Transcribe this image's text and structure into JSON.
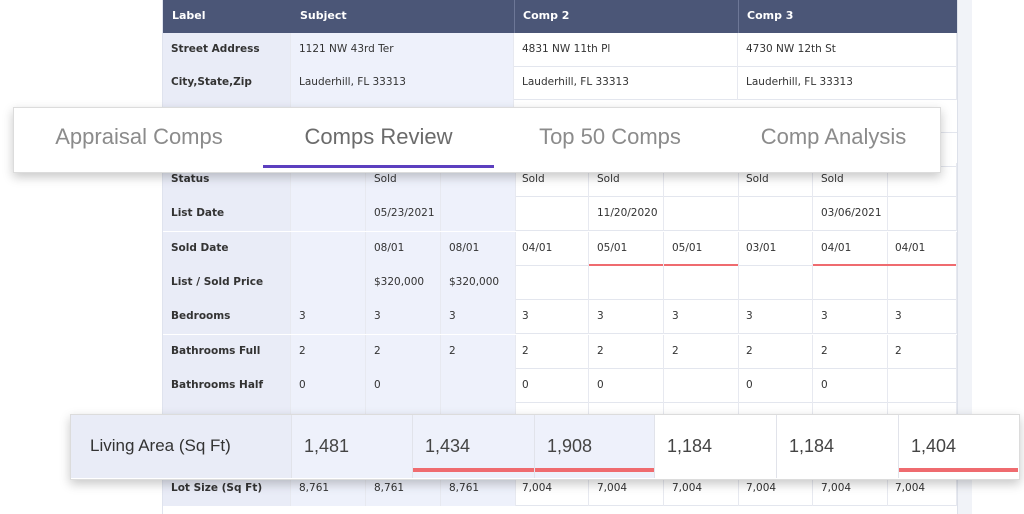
{
  "header": {
    "label": "Label",
    "subject": "Subject",
    "comp2": "Comp 2",
    "comp3": "Comp 3"
  },
  "rows_top": [
    {
      "label": "Street Address",
      "subject": "1121 NW 43rd Ter",
      "comp2": "4831 NW 11th Pl",
      "comp3": "4730 NW 12th St"
    },
    {
      "label": "City,State,Zip",
      "subject": "Lauderhill, FL 33313",
      "comp2": "Lauderhill, FL 33313",
      "comp3": "Lauderhill, FL 33313"
    }
  ],
  "tabs": [
    {
      "label": "Appraisal Comps",
      "active": false
    },
    {
      "label": "Comps Review",
      "active": true
    },
    {
      "label": "Top 50 Comps",
      "active": false
    },
    {
      "label": "Comp Analysis",
      "active": false
    }
  ],
  "rows": [
    {
      "label": "Status",
      "values": [
        "",
        "Sold",
        "",
        "Sold",
        "Sold",
        "",
        "Sold",
        "Sold",
        ""
      ]
    },
    {
      "label": "List Date",
      "values": [
        "",
        "05/23/2021",
        "",
        "",
        "11/20/2020",
        "",
        "",
        "03/06/2021",
        ""
      ]
    },
    {
      "label": "Sold Date",
      "values": [
        "",
        "08/01",
        "08/01",
        "04/01",
        "05/01",
        "05/01",
        "03/01",
        "04/01",
        "04/01"
      ]
    },
    {
      "label": "List / Sold Price",
      "values": [
        "",
        "$320,000",
        "$320,000",
        "",
        "",
        "",
        "",
        "",
        ""
      ]
    },
    {
      "label": "Bedrooms",
      "values": [
        "3",
        "3",
        "3",
        "3",
        "3",
        "3",
        "3",
        "3",
        "3"
      ]
    },
    {
      "label": "Bathrooms Full",
      "values": [
        "2",
        "2",
        "2",
        "2",
        "2",
        "2",
        "2",
        "2",
        "2"
      ]
    },
    {
      "label": "Bathrooms Half",
      "values": [
        "0",
        "0",
        "",
        "0",
        "0",
        "",
        "0",
        "0",
        ""
      ]
    },
    {
      "label": "",
      "values": [
        "",
        "",
        "",
        "",
        "",
        "",
        "",
        "",
        ""
      ]
    },
    {
      "label": "",
      "values": [
        "",
        "",
        "",
        "",
        "",
        "",
        "",
        "",
        ""
      ]
    },
    {
      "label": "Lot Size (Sq Ft)",
      "values": [
        "8,761",
        "8,761",
        "8,761",
        "7,004",
        "7,004",
        "7,004",
        "7,004",
        "7,004",
        "7,004"
      ]
    }
  ],
  "living_area": {
    "label": "Living Area (Sq Ft)",
    "values": [
      "1,481",
      "1,434",
      "1,908",
      "1,184",
      "1,184",
      "1,404"
    ]
  },
  "colors": {
    "header_bg": "#4b5677",
    "label_bg": "#e9ecf7",
    "accent_underline": "#ef6b6f",
    "active_tab": "#5c3fbf"
  }
}
